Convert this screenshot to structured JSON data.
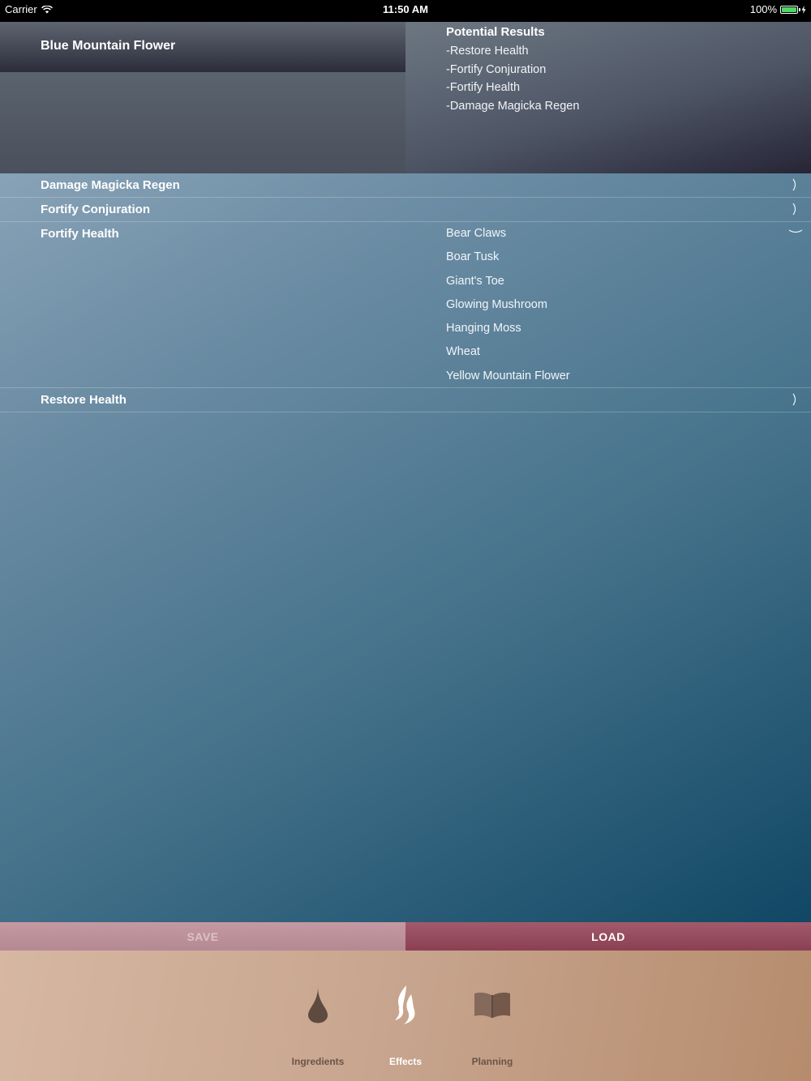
{
  "status_bar": {
    "carrier": "Carrier",
    "time": "11:50 AM",
    "battery": "100%"
  },
  "header": {
    "ingredient_name": "Blue Mountain Flower",
    "results_title": "Potential Results",
    "results": [
      "-Restore Health",
      "-Fortify Conjuration",
      "-Fortify Health",
      "-Damage Magicka Regen"
    ]
  },
  "effects": [
    {
      "label": "Damage Magicka Regen",
      "expanded": false,
      "ingredients": []
    },
    {
      "label": "Fortify Conjuration",
      "expanded": false,
      "ingredients": []
    },
    {
      "label": "Fortify Health",
      "expanded": true,
      "ingredients": [
        "Bear Claws",
        "Boar Tusk",
        "Giant's Toe",
        "Glowing Mushroom",
        "Hanging Moss",
        "Wheat",
        "Yellow Mountain Flower"
      ]
    },
    {
      "label": "Restore Health",
      "expanded": false,
      "ingredients": []
    }
  ],
  "actions": {
    "save_label": "SAVE",
    "load_label": "LOAD"
  },
  "tabs": [
    {
      "label": "Ingredients",
      "icon": "drop-icon",
      "selected": false
    },
    {
      "label": "Effects",
      "icon": "flame-icon",
      "selected": true
    },
    {
      "label": "Planning",
      "icon": "book-icon",
      "selected": false
    }
  ],
  "colors": {
    "load_button": "#8b3f53",
    "save_button": "#c599a2",
    "tab_inactive": "#6b5448",
    "tab_active": "#ffffff"
  }
}
